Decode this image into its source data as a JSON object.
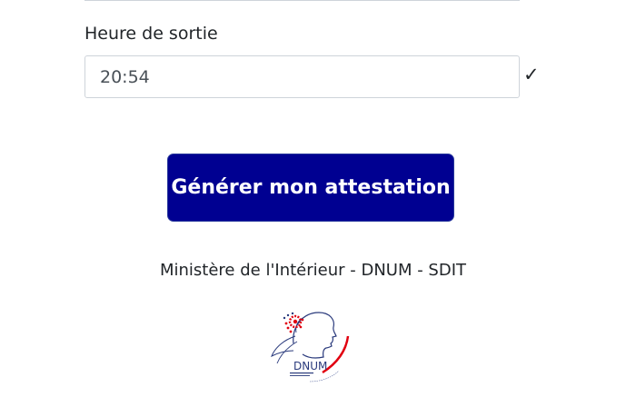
{
  "form": {
    "exit_time_label": "Heure de sortie",
    "exit_time_value": "20:54",
    "valid_icon": "check-icon"
  },
  "actions": {
    "generate_label": "Générer mon attestation"
  },
  "footer": {
    "ministry_text": "Ministère de l'Intérieur - DNUM - SDIT",
    "logo_text": "DNUM"
  },
  "colors": {
    "primary": "#000091",
    "logo_red": "#e1000f",
    "logo_blue": "#2a3a7c"
  }
}
